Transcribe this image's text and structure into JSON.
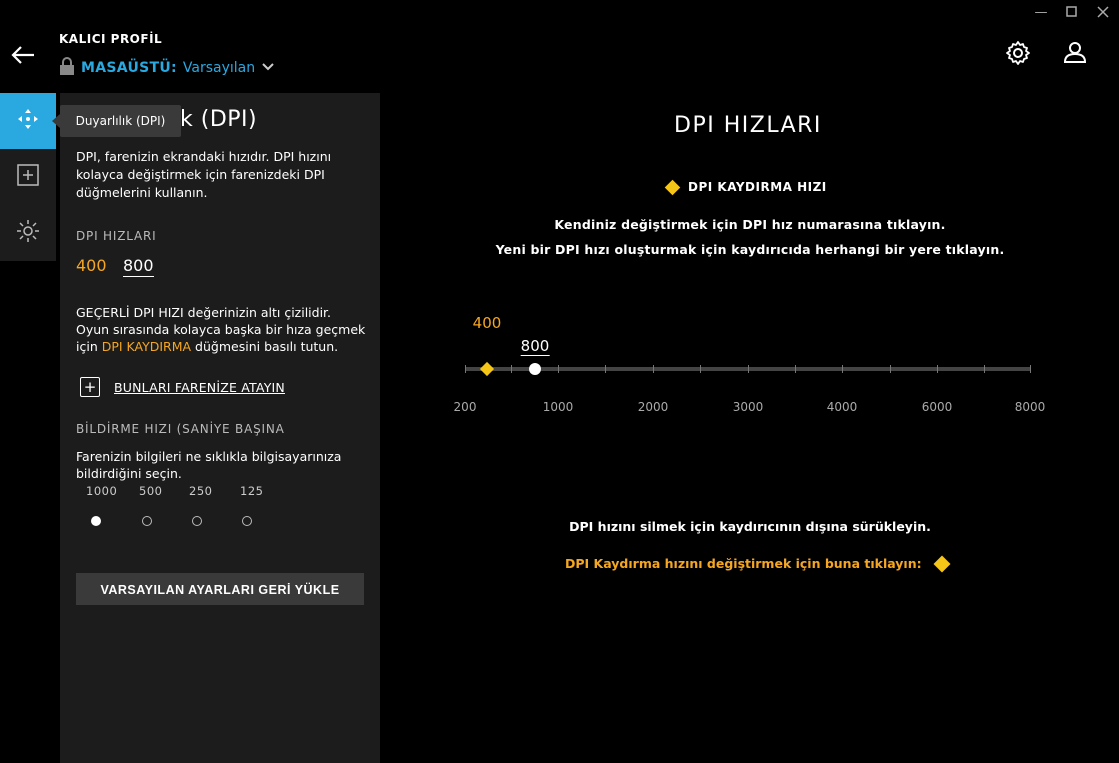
{
  "header": {
    "profile_title": "KALICI PROFİL",
    "profile_name": "MASAÜSTÜ:",
    "profile_value": "Varsayılan"
  },
  "tooltip": "Duyarlılık (DPI)",
  "panel": {
    "title": "k (DPI)",
    "description": "DPI, farenizin ekrandaki hızıdır. DPI hızını kolayca değiştirmek için farenizdeki DPI düğmelerini kullanın.",
    "dpi_section_label": "DPI HIZLARI",
    "dpi_values": [
      "400",
      "800"
    ],
    "desc2_a": "GEÇERLİ DPI HIZI değerinizin altı çizilidir. Oyun sırasında kolayca başka bir hıza geçmek için ",
    "desc2_highlight": "DPI KAYDIRMA",
    "desc2_b": " düğmesini basılı tutun.",
    "assign_label": "BUNLARI FARENİZE ATAYIN",
    "report_section_label": "BİLDİRME HIZI (SANİYE BAŞINA",
    "report_desc": "Farenizin bilgileri ne sıklıkla bilgisayarınıza bildirdiğini seçin.",
    "report_rates": [
      "1000",
      "500",
      "250",
      "125"
    ],
    "report_selected": "1000",
    "reset_label": "VARSAYILAN AYARLARI GERİ YÜKLE"
  },
  "main": {
    "title": "DPI HIZLARI",
    "legend_label": "DPI KAYDIRMA HIZI",
    "instr1": "Kendiniz değiştirmek için DPI hız numarasına tıklayın.",
    "instr2": "Yeni bir DPI hızı oluşturmak için kaydırıcıda herhangi bir yere tıklayın.",
    "shift_dpi": "400",
    "current_dpi": "800",
    "slider_ticks": [
      "200",
      "1000",
      "2000",
      "3000",
      "4000",
      "6000",
      "8000"
    ],
    "footer_instr": "DPI hızını silmek için kaydırıcının dışına sürükleyin.",
    "footer_link": "DPI Kaydırma hızını değiştirmek için buna tıklayın:"
  },
  "colors": {
    "accent_blue": "#2aa8e0",
    "accent_orange": "#f5a623",
    "accent_yellow": "#f5c518"
  },
  "icons": {
    "window": [
      "minimize-icon",
      "maximize-icon",
      "close-icon"
    ],
    "header": [
      "back-arrow-icon",
      "lock-icon",
      "chevron-down-icon",
      "gear-icon",
      "user-icon"
    ],
    "rail": [
      "move-arrows-icon",
      "plus-square-icon",
      "sun-icon"
    ]
  }
}
